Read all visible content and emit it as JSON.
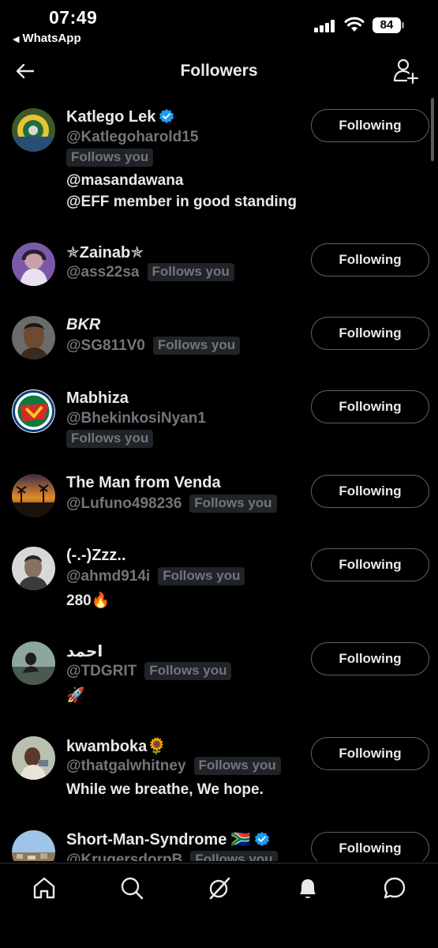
{
  "status_bar": {
    "time": "07:49",
    "back_app": "WhatsApp",
    "battery": "84"
  },
  "header": {
    "title": "Followers"
  },
  "followers": [
    {
      "name": "Katlego Lek",
      "verified": true,
      "handle": "@Katlegoharold15",
      "follows_you": "Follows you",
      "bio_lines": [
        "@masandawana",
        "@EFF member in good standing"
      ],
      "button": "Following"
    },
    {
      "name": "✯Zainab✯",
      "handle": "@ass22sa",
      "follows_you": "Follows you",
      "button": "Following"
    },
    {
      "name": "BKR",
      "handle": "@SG811V0",
      "follows_you": "Follows you",
      "button": "Following"
    },
    {
      "name": "Mabhiza",
      "handle": "@BhekinkosiNyan1",
      "follows_you": "Follows you",
      "button": "Following"
    },
    {
      "name": "The Man from Venda",
      "handle": "@Lufuno498236",
      "follows_you": "Follows you",
      "button": "Following"
    },
    {
      "name": "(-.-)Zzz..",
      "handle": "@ahmd914i",
      "follows_you": "Follows you",
      "bio_lines": [
        "280🔥"
      ],
      "button": "Following"
    },
    {
      "name": "احمد",
      "handle": "@TDGRIT",
      "follows_you": "Follows you",
      "bio_lines": [
        "🚀"
      ],
      "button": "Following"
    },
    {
      "name": "kwamboka🌻",
      "handle": "@thatgalwhitney",
      "follows_you": "Follows you",
      "bio_lines": [
        "While we breathe, We hope."
      ],
      "button": "Following"
    },
    {
      "name": "Short-Man-Syndrome 🇿🇦",
      "verified": true,
      "handle": "@KrugersdorpB",
      "follows_you": "Follows you",
      "button": "Following"
    }
  ],
  "nav": {
    "items": [
      "home-icon",
      "search-icon",
      "grok-icon",
      "notifications-icon",
      "messages-icon"
    ]
  },
  "colors": {
    "background": "#000000",
    "primary_text": "#e7e9ea",
    "secondary_text": "#71767b",
    "badge_bg": "#202327",
    "verified_blue": "#1d9bf0",
    "button_border": "#536471"
  }
}
